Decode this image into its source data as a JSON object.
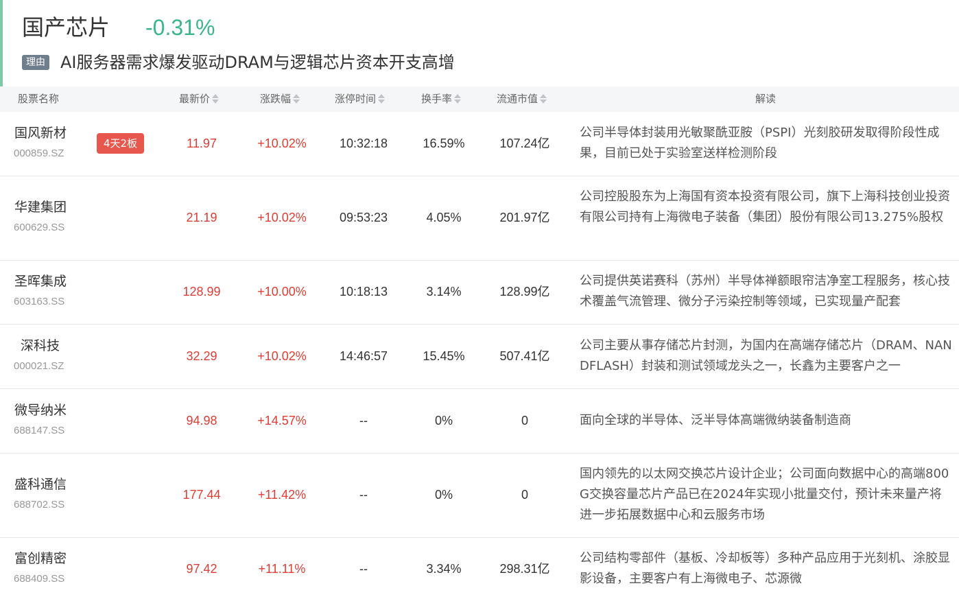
{
  "sector": {
    "name": "国产芯片",
    "change": "-0.31%",
    "reason_tag": "理由",
    "reason_text": "AI服务器需求爆发驱动DRAM与逻辑芯片资本开支高增"
  },
  "colors": {
    "accent": "#7dc8a6",
    "down_green": "#3bb58a",
    "up_red": "#e03c34",
    "badge_red": "#e8574e"
  },
  "columns": {
    "name": "股票名称",
    "price": "最新价",
    "change": "涨跌幅",
    "limit_time": "涨停时间",
    "turnover": "换手率",
    "market_cap": "流通市值",
    "analysis": "解读"
  },
  "rows": [
    {
      "name": "国风新材",
      "code": "000859.SZ",
      "badge": "4天2板",
      "price": "11.97",
      "change": "+10.02%",
      "limit_time": "10:32:18",
      "turnover": "16.59%",
      "market_cap": "107.24亿",
      "analysis": "公司半导体封装用光敏聚酰亚胺（PSPI）光刻胶研发取得阶段性成果，目前已处于实验室送样检测阶段"
    },
    {
      "name": "华建集团",
      "code": "600629.SS",
      "badge": "",
      "price": "21.19",
      "change": "+10.02%",
      "limit_time": "09:53:23",
      "turnover": "4.05%",
      "market_cap": "201.97亿",
      "analysis": "公司控股股东为上海国有资本投资有限公司，旗下上海科技创业投资有限公司持有上海微电子装备（集团）股份有限公司13.275%股权"
    },
    {
      "name": "圣晖集成",
      "code": "603163.SS",
      "badge": "",
      "price": "128.99",
      "change": "+10.00%",
      "limit_time": "10:18:13",
      "turnover": "3.14%",
      "market_cap": "128.99亿",
      "analysis": "公司提供英诺赛科（苏州）半导体禅额眼帘洁净室工程服务，核心技术覆盖气流管理、微分子污染控制等领域，已实现量产配套"
    },
    {
      "name": "深科技",
      "code": "000021.SZ",
      "badge": "",
      "price": "32.29",
      "change": "+10.02%",
      "limit_time": "14:46:57",
      "turnover": "15.45%",
      "market_cap": "507.41亿",
      "analysis": "公司主要从事存储芯片封测，为国内在高端存储芯片（DRAM、NANDFLASH）封装和测试领域龙头之一，长鑫为主要客户之一"
    },
    {
      "name": "微导纳米",
      "code": "688147.SS",
      "badge": "",
      "price": "94.98",
      "change": "+14.57%",
      "limit_time": "--",
      "turnover": "0%",
      "market_cap": "0",
      "analysis": "面向全球的半导体、泛半导体高端微纳装备制造商"
    },
    {
      "name": "盛科通信",
      "code": "688702.SS",
      "badge": "",
      "price": "177.44",
      "change": "+11.42%",
      "limit_time": "--",
      "turnover": "0%",
      "market_cap": "0",
      "analysis": "国内领先的以太网交换芯片设计企业；公司面向数据中心的高端800G交换容量芯片产品已在2024年实现小批量交付，预计未来量产将进一步拓展数据中心和云服务市场"
    },
    {
      "name": "富创精密",
      "code": "688409.SS",
      "badge": "",
      "price": "97.42",
      "change": "+11.11%",
      "limit_time": "--",
      "turnover": "3.34%",
      "market_cap": "298.31亿",
      "analysis": "公司结构零部件（基板、冷却板等）多种产品应用于光刻机、涂胶显影设备，主要客户有上海微电子、芯源微"
    }
  ]
}
